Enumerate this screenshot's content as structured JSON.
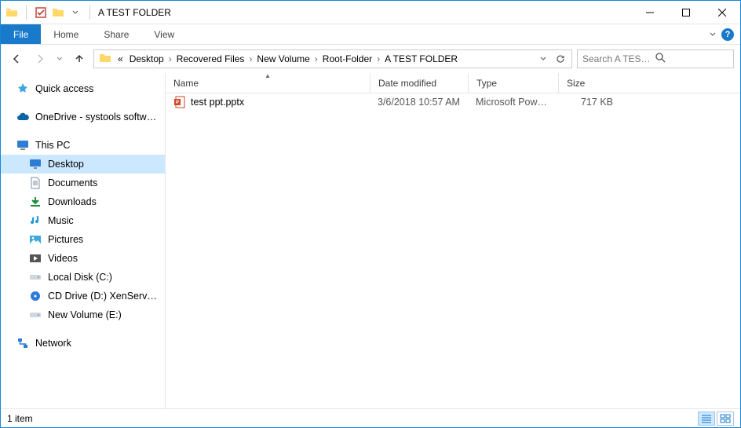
{
  "window": {
    "title": "A TEST FOLDER"
  },
  "ribbon": {
    "file": "File",
    "tabs": [
      "Home",
      "Share",
      "View"
    ]
  },
  "breadcrumbs": {
    "prefix": "«",
    "items": [
      "Desktop",
      "Recovered Files",
      "New Volume",
      "Root-Folder",
      "A TEST FOLDER"
    ]
  },
  "search": {
    "placeholder": "Search A TEST FOLDER"
  },
  "sidebar": {
    "quick_access": "Quick access",
    "onedrive": "OneDrive - systools software",
    "this_pc": "This PC",
    "children": [
      {
        "label": "Desktop",
        "icon": "desktop",
        "selected": true
      },
      {
        "label": "Documents",
        "icon": "documents"
      },
      {
        "label": "Downloads",
        "icon": "downloads"
      },
      {
        "label": "Music",
        "icon": "music"
      },
      {
        "label": "Pictures",
        "icon": "pictures"
      },
      {
        "label": "Videos",
        "icon": "videos"
      },
      {
        "label": "Local Disk (C:)",
        "icon": "drive"
      },
      {
        "label": "CD Drive (D:) XenServer Tools",
        "icon": "cd"
      },
      {
        "label": "New Volume (E:)",
        "icon": "drive"
      }
    ],
    "network": "Network"
  },
  "columns": {
    "name": "Name",
    "date": "Date modified",
    "type": "Type",
    "size": "Size"
  },
  "files": [
    {
      "name": "test ppt.pptx",
      "date": "3/6/2018 10:57 AM",
      "type": "Microsoft PowerP...",
      "size": "717 KB",
      "icon": "pptx"
    }
  ],
  "status": {
    "text": "1 item"
  }
}
